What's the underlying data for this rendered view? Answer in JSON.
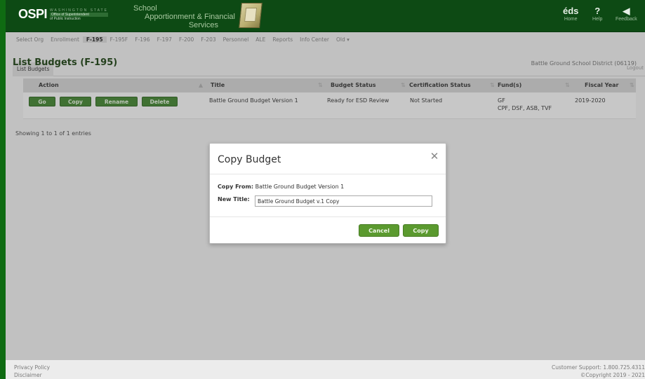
{
  "header": {
    "logo": {
      "main": "OSPI",
      "agency_top": "WASHINGTON STATE",
      "agency_line1": "Office of Superintendent",
      "agency_line2": "of Public Instruction"
    },
    "app_title": {
      "line1": "School",
      "line2": "Apportionment & Financial",
      "line3": "Services"
    },
    "right_links": [
      {
        "glyph": "éds",
        "label": "Home"
      },
      {
        "glyph": "?",
        "label": "Help"
      },
      {
        "glyph": "◀",
        "label": "Feedback"
      }
    ]
  },
  "nav": {
    "items": [
      {
        "label": "Select Org",
        "active": false
      },
      {
        "label": "Enrollment",
        "active": false
      },
      {
        "label": "F-195",
        "active": true
      },
      {
        "label": "F-195F",
        "active": false
      },
      {
        "label": "F-196",
        "active": false
      },
      {
        "label": "F-197",
        "active": false
      },
      {
        "label": "F-200",
        "active": false
      },
      {
        "label": "F-203",
        "active": false
      },
      {
        "label": "Personnel",
        "active": false
      },
      {
        "label": "ALE",
        "active": false
      },
      {
        "label": "Reports",
        "active": false
      },
      {
        "label": "Info Center",
        "active": false
      },
      {
        "label": "Old ▾",
        "active": false
      }
    ],
    "subtab": "List Budgets",
    "logout": "Logout"
  },
  "page": {
    "title": "List Budgets (F-195)",
    "district": "Battle Ground School District (06119)",
    "columns": [
      "Action",
      "Title",
      "Budget Status",
      "Certification Status",
      "Fund(s)",
      "Fiscal Year"
    ],
    "row": {
      "buttons": [
        "Go",
        "Copy",
        "Rename",
        "Delete"
      ],
      "title": "Battle Ground Budget Version 1",
      "budget_status": "Ready for ESD Review",
      "certification_status": "Not Started",
      "funds_line1": "GF",
      "funds_line2": "CPF, DSF, ASB, TVF",
      "fiscal_year": "2019-2020"
    },
    "showing": "Showing 1 to 1 of 1 entries"
  },
  "modal": {
    "title": "Copy Budget",
    "copy_from_label": "Copy From:",
    "copy_from_value": "Battle Ground Budget Version 1",
    "new_title_label": "New Title:",
    "new_title_value": "Battle Ground Budget v.1 Copy",
    "cancel_label": "Cancel",
    "copy_label": "Copy"
  },
  "footer": {
    "privacy": "Privacy Policy",
    "disclaimer": "Disclaimer",
    "support": "Customer Support: 1.800.725.4311",
    "copyright": "©Copyright 2019 - 2021"
  }
}
